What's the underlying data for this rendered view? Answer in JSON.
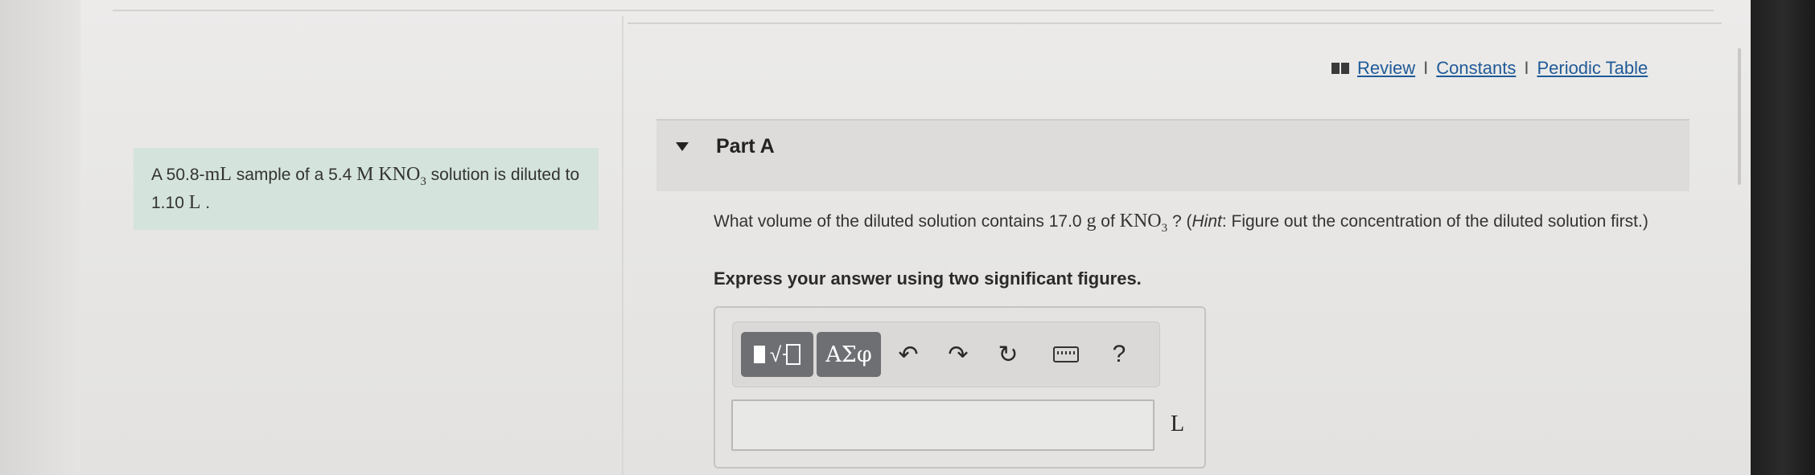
{
  "header_links": {
    "review": "Review",
    "separator": "I",
    "constants": "Constants",
    "periodic_table": "Periodic Table"
  },
  "problem": {
    "prefix": "A 50.8-",
    "volume_unit": "mL",
    "middle": " sample of a 5.4 ",
    "molarity_unit": "M",
    "compound": "KNO",
    "compound_sub": "3",
    "suffix": " solution is diluted to 1.10 ",
    "final_unit": "L",
    "end": " ."
  },
  "part": {
    "label": "Part A"
  },
  "question": {
    "text_before": "What volume of the diluted solution contains 17.0 ",
    "mass_unit": "g",
    "of": " of ",
    "compound": "KNO",
    "compound_sub": "3",
    "after": " ? (",
    "hint_label": "Hint",
    "hint_text": ": Figure out the concentration of the diluted solution first.)"
  },
  "instruction": "Express your answer using two significant figures.",
  "toolbar": {
    "greek_label": "ΑΣφ",
    "undo_glyph": "↶",
    "redo_glyph": "↷",
    "reset_glyph": "↻",
    "help_label": "?"
  },
  "answer": {
    "value": "",
    "unit": "L"
  },
  "icons": {
    "review": "book-icon",
    "collapse": "triangle-down-icon",
    "undo": "undo-icon",
    "redo": "redo-icon",
    "reset": "reset-icon",
    "keyboard": "keyboard-icon"
  },
  "colors": {
    "link": "#1f5a98",
    "problem_bg": "#d4e3dc",
    "toolbar_dark": "#6d6f72"
  }
}
